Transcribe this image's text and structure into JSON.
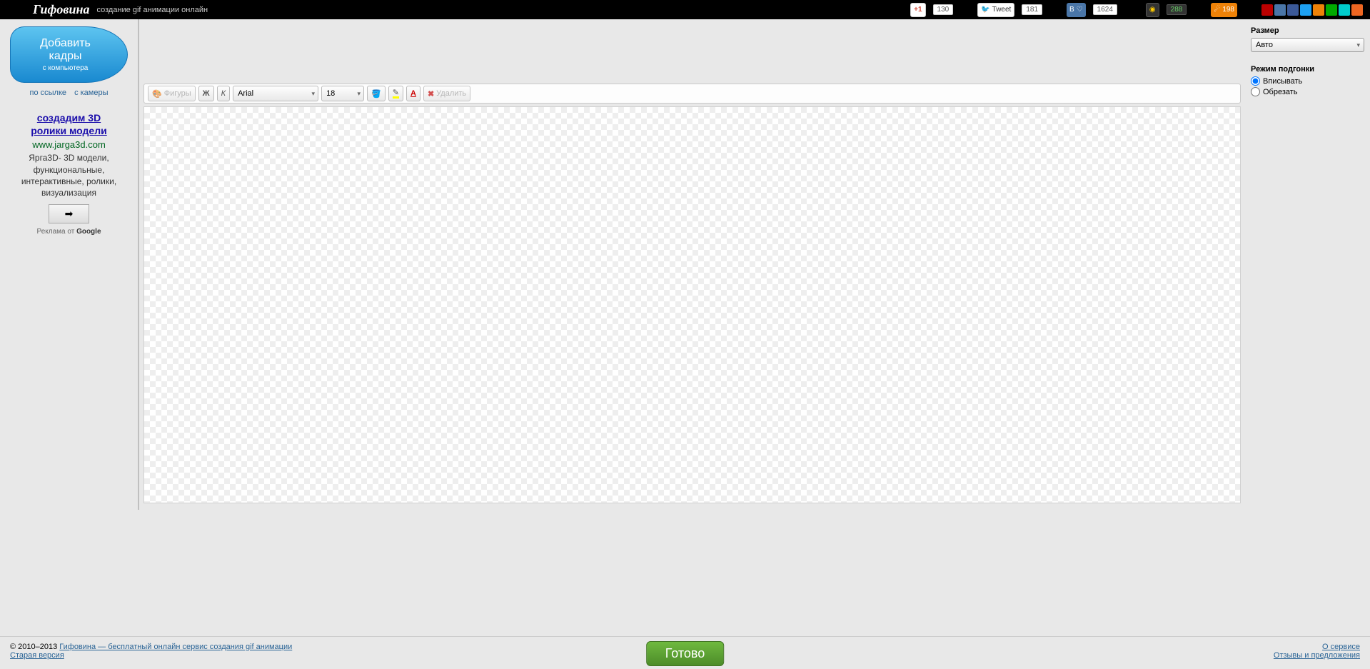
{
  "header": {
    "logo": "Гифовина",
    "tagline": "создание gif анимации онлайн",
    "social": {
      "gplus_label": "+1",
      "gplus_count": "130",
      "tweet_label": "Tweet",
      "tweet_count": "181",
      "vk_label": "В",
      "vk_count": "1624",
      "donate_count": "288",
      "ok_count": "198"
    }
  },
  "sidebar": {
    "add_frames": "Добавить кадры",
    "add_frames_sub": "с компьютера",
    "link_url": "по ссылке",
    "link_cam": "с камеры",
    "ad": {
      "title_line1": "создадим 3D",
      "title_line2": "ролики модели",
      "url": "www.jarga3d.com",
      "desc": "Ярга3D- 3D модели, функциональные, интерактивные, ролики, визуализация",
      "arrow": "➡",
      "footer_prefix": "Реклама от ",
      "footer_brand": "Google"
    }
  },
  "toolbar": {
    "shapes": "Фигуры",
    "bold": "Ж",
    "italic": "К",
    "font": "Arial",
    "size": "18",
    "delete": "Удалить"
  },
  "right": {
    "size_label": "Размер",
    "size_value": "Авто",
    "fit_label": "Режим подгонки",
    "fit_inscribe": "Вписывать",
    "fit_crop": "Обрезать"
  },
  "footer": {
    "copyright_prefix": "© 2010–2013 ",
    "main_link": "Гифовина — бесплатный онлайн сервис создания gif анимации",
    "old_version": "Старая версия",
    "about": "О сервисе",
    "feedback": "Отзывы и предложения",
    "ready": "Готово"
  }
}
